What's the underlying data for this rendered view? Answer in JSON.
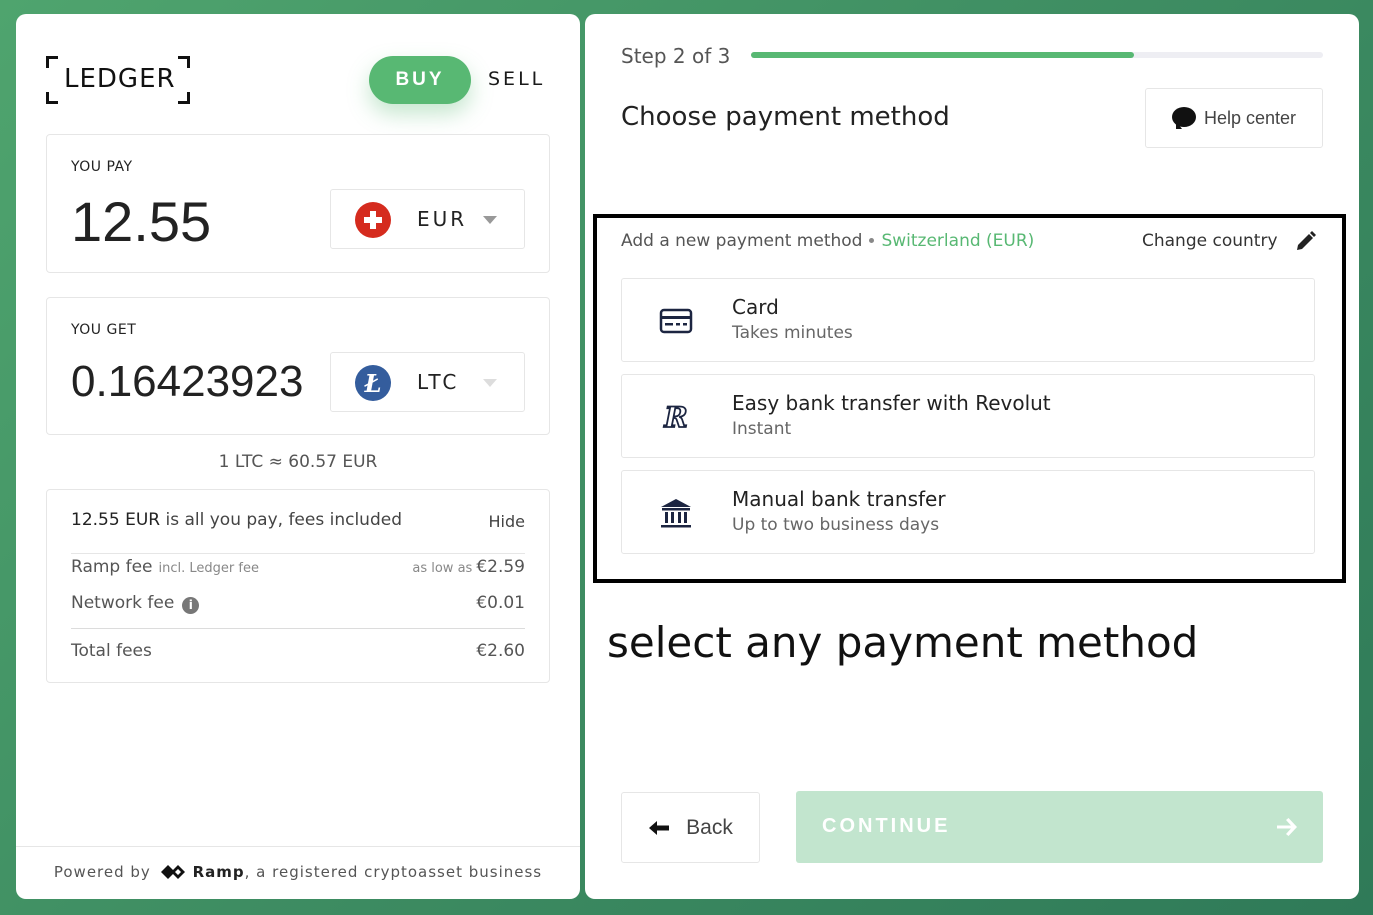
{
  "brand": {
    "logo_text": "LEDGER"
  },
  "mode_tabs": {
    "buy_label": "BUY",
    "sell_label": "SELL"
  },
  "you_pay": {
    "label": "YOU PAY",
    "amount": "12.55",
    "currency": "EUR",
    "currency_icon": "swiss-flag-icon"
  },
  "you_get": {
    "label": "YOU GET",
    "amount": "0.16423923",
    "currency": "LTC",
    "currency_icon": "litecoin-icon"
  },
  "rate": "1 LTC ≈ 60.57 EUR",
  "fees": {
    "summary_amount": "12.55 EUR",
    "summary_text": " is all you pay, fees included",
    "hide_label": "Hide",
    "ramp_fee_label": "Ramp fee",
    "ramp_fee_sub": "incl. Ledger fee",
    "ramp_fee_prefix": "as low as",
    "ramp_fee_value": "€2.59",
    "network_fee_label": "Network fee",
    "network_fee_value": "€0.01",
    "total_label": "Total fees",
    "total_value": "€2.60"
  },
  "footer": {
    "powered_by": "Powered by",
    "ramp_name": "Ramp",
    "tail": ", a registered cryptoasset business"
  },
  "wizard": {
    "step_text": "Step 2 of 3",
    "progress": 0.67,
    "title": "Choose payment method",
    "help_label": "Help center"
  },
  "payment": {
    "add_text": "Add a new payment method",
    "country": "Switzerland (EUR)",
    "change_country": "Change country",
    "methods": [
      {
        "name": "Card",
        "desc": "Takes minutes",
        "icon": "card-icon"
      },
      {
        "name": "Easy bank transfer with Revolut",
        "desc": "Instant",
        "icon": "revolut-icon"
      },
      {
        "name": "Manual bank transfer",
        "desc": "Up to two business days",
        "icon": "bank-icon"
      }
    ]
  },
  "annotation": "select any payment method",
  "nav": {
    "back_label": "Back",
    "continue_label": "CONTINUE"
  },
  "colors": {
    "accent": "#58b873",
    "continue_disabled": "#c2e5ce",
    "background": "#4fa46e"
  }
}
